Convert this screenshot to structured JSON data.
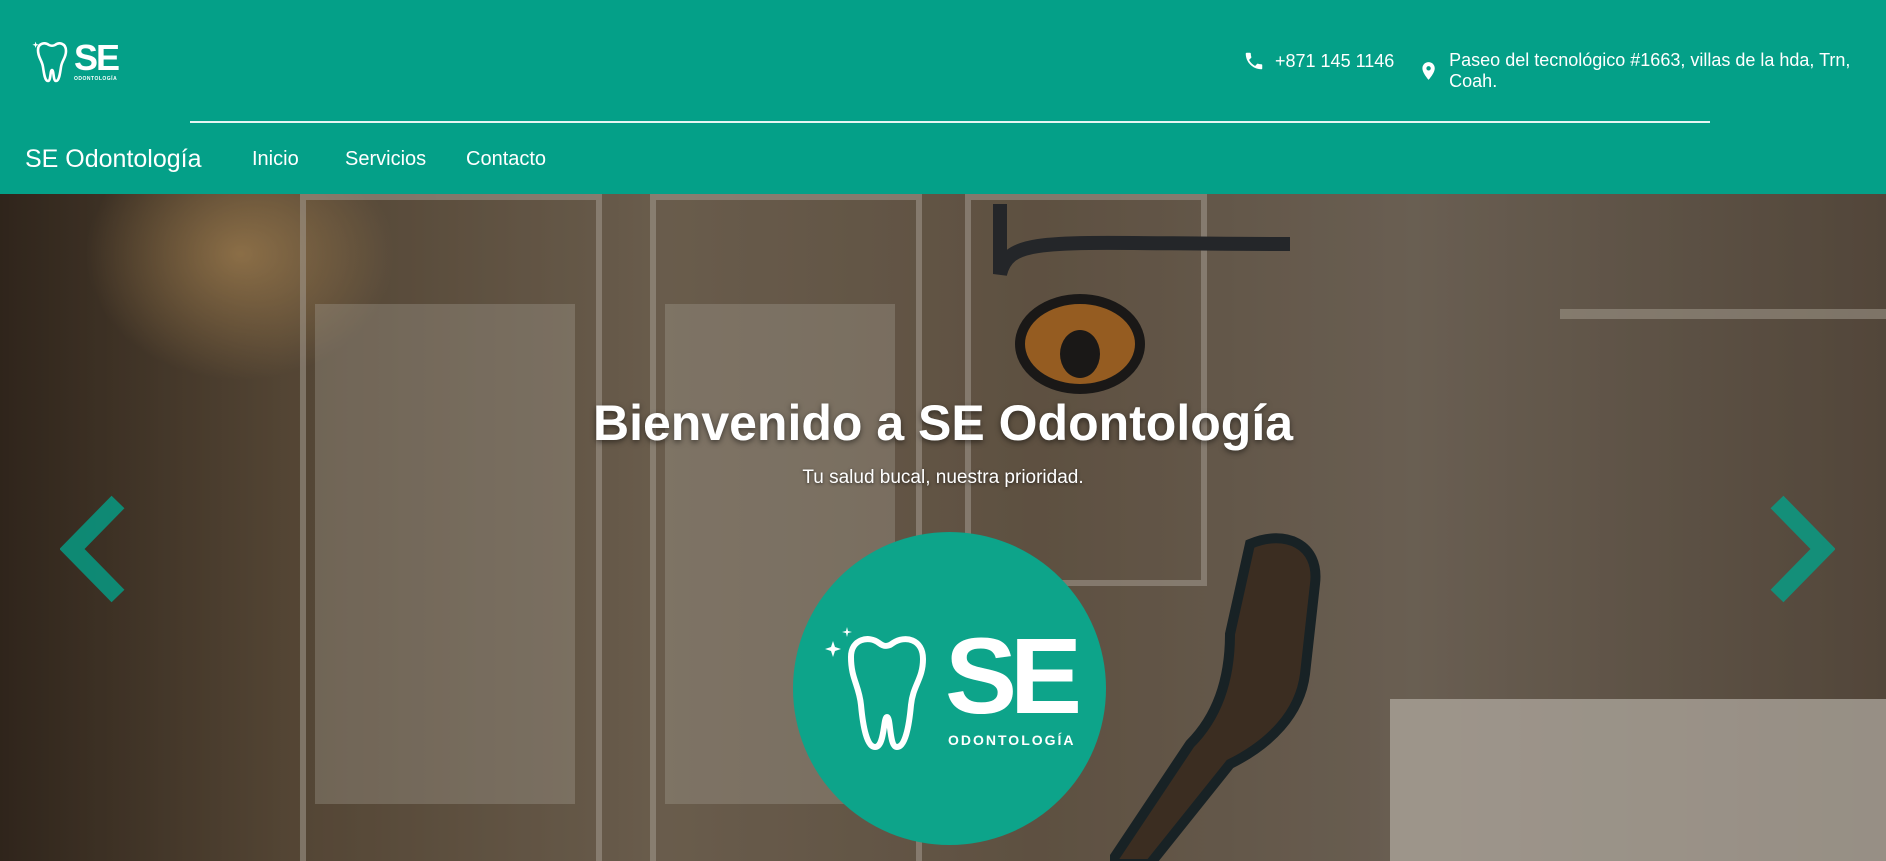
{
  "header": {
    "logo": {
      "mark": "SE",
      "subtitle": "ODONTOLOGÍA",
      "icon": "tooth-icon"
    },
    "phone": {
      "icon": "phone-icon",
      "text": "+871 145 1146"
    },
    "address": {
      "icon": "location-pin-icon",
      "text": "Paseo del tecnológico #1663, villas de la hda, Trn, Coah."
    },
    "brand": "SE Odontología",
    "nav": [
      "Inicio",
      "Servicios",
      "Contacto"
    ]
  },
  "hero": {
    "title": "Bienvenido a SE Odontología",
    "subtitle": "Tu salud bucal, nuestra prioridad.",
    "logo": {
      "mark": "SE",
      "subtitle": "ODONTOLOGÍA",
      "icon": "tooth-icon"
    },
    "controls": {
      "prev_icon": "chevron-left-icon",
      "next_icon": "chevron-right-icon"
    }
  },
  "colors": {
    "primary": "#04a088",
    "logo_circle": "#0da48a",
    "text": "#ffffff"
  }
}
